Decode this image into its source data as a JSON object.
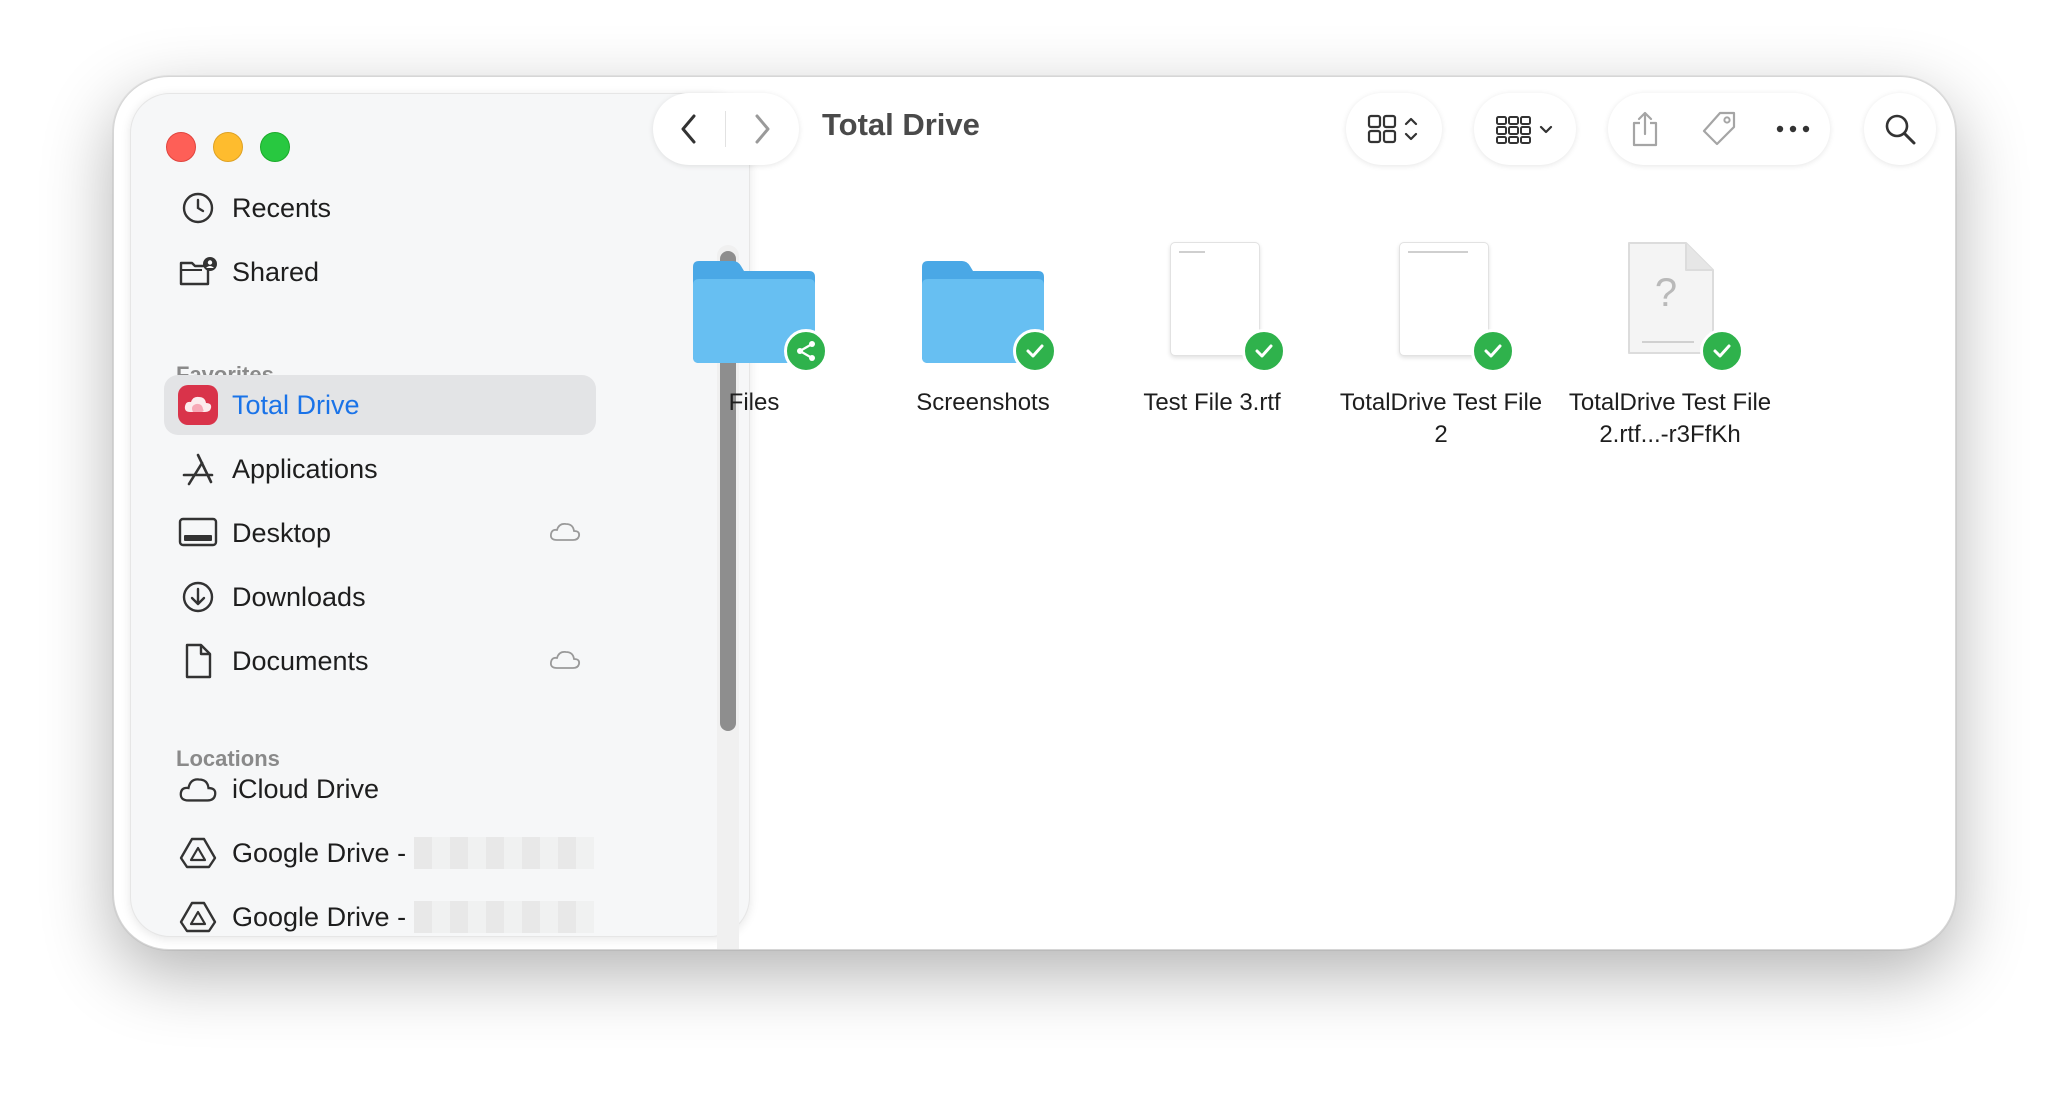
{
  "window": {
    "title": "Total Drive"
  },
  "sidebar": {
    "top_items": [
      {
        "label": "Recents",
        "icon": "clock-icon"
      },
      {
        "label": "Shared",
        "icon": "shared-folder-icon"
      }
    ],
    "favorites_header": "Favorites",
    "favorites": [
      {
        "label": "Total Drive",
        "icon": "total-drive-icon",
        "selected": true
      },
      {
        "label": "Applications",
        "icon": "applications-icon"
      },
      {
        "label": "Desktop",
        "icon": "desktop-icon",
        "cloud": true
      },
      {
        "label": "Downloads",
        "icon": "download-icon"
      },
      {
        "label": "Documents",
        "icon": "document-icon",
        "cloud": true
      }
    ],
    "locations_header": "Locations",
    "locations": [
      {
        "label": "iCloud Drive",
        "icon": "cloud-icon"
      },
      {
        "label": "Google Drive -",
        "icon": "google-drive-icon"
      },
      {
        "label": "Google Drive -",
        "icon": "google-drive-icon"
      }
    ]
  },
  "files": [
    {
      "name": "Files",
      "kind": "folder",
      "badge": "shared"
    },
    {
      "name": "Screenshots",
      "kind": "folder",
      "badge": "synced"
    },
    {
      "name": "Test File 3.rtf",
      "kind": "document",
      "badge": "synced"
    },
    {
      "name": "TotalDrive Test File 2",
      "kind": "document",
      "badge": "synced"
    },
    {
      "name": "TotalDrive Test File 2.rtf...-r3FfKh",
      "kind": "unknown",
      "badge": "synced"
    }
  ],
  "colors": {
    "accent": "#1a73e8",
    "synced_badge": "#2fb24c",
    "folder": "#5bb8ee"
  }
}
